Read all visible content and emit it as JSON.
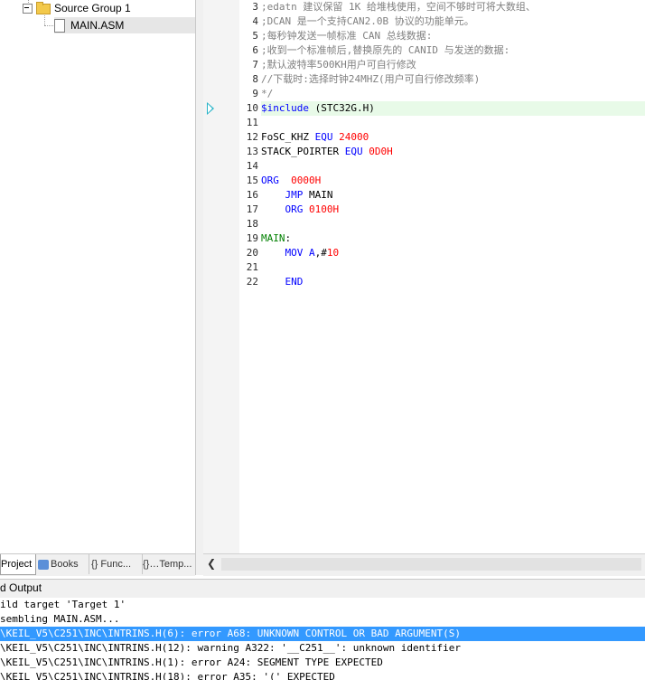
{
  "project": {
    "tree": [
      {
        "label": "Source Group 1",
        "type": "group"
      },
      {
        "label": "MAIN.ASM",
        "type": "file"
      }
    ],
    "tabs": [
      {
        "label": "Project",
        "icon": "project-icon",
        "active": true
      },
      {
        "label": "Books",
        "icon": "books-icon",
        "active": false
      },
      {
        "label": "{} Func...",
        "icon": "functions-icon",
        "active": false
      },
      {
        "label": "{}…Temp...",
        "icon": "templates-icon",
        "active": false
      }
    ]
  },
  "editor": {
    "lines": [
      {
        "n": "3",
        "text": ";edatn 建议保留 1K 给堆栈使用，空间不够时可将大数组、",
        "kind": "comment"
      },
      {
        "n": "4",
        "text": ";DCAN 是一个支持CAN2.0B 协议的功能单元。",
        "kind": "comment"
      },
      {
        "n": "5",
        "text": ";每秒钟发送一帧标准 CAN 总线数据:",
        "kind": "comment"
      },
      {
        "n": "6",
        "text": ";收到一个标准帧后,替换原先的 CANID 与发送的数据:",
        "kind": "comment"
      },
      {
        "n": "7",
        "text": ";默认波特率500KH用户可自行修改",
        "kind": "comment"
      },
      {
        "n": "8",
        "text": "//下载时:选择时钟24MHZ(用户可自行修改频率)",
        "kind": "comment"
      },
      {
        "n": "9",
        "text": "*/",
        "kind": "comment"
      },
      {
        "n": "10",
        "parts": [
          {
            "t": "$include",
            "c": "kw"
          },
          {
            "t": " (STC32G.H)",
            "c": "plain"
          }
        ],
        "highlight": true
      },
      {
        "n": "11",
        "text": "",
        "kind": "plain"
      },
      {
        "n": "12",
        "parts": [
          {
            "t": "FoSC_KHZ ",
            "c": "plain"
          },
          {
            "t": "EQU",
            "c": "kw"
          },
          {
            "t": " ",
            "c": "plain"
          },
          {
            "t": "24000",
            "c": "num"
          }
        ]
      },
      {
        "n": "13",
        "parts": [
          {
            "t": "STACK_POIRTER ",
            "c": "plain"
          },
          {
            "t": "EQU",
            "c": "kw"
          },
          {
            "t": " ",
            "c": "plain"
          },
          {
            "t": "0D0H",
            "c": "num"
          }
        ]
      },
      {
        "n": "14",
        "text": "",
        "kind": "plain"
      },
      {
        "n": "15",
        "parts": [
          {
            "t": "ORG",
            "c": "kw"
          },
          {
            "t": "  ",
            "c": "plain"
          },
          {
            "t": "0000H",
            "c": "num"
          }
        ]
      },
      {
        "n": "16",
        "parts": [
          {
            "t": "    ",
            "c": "plain"
          },
          {
            "t": "JMP",
            "c": "kw"
          },
          {
            "t": " MAIN",
            "c": "plain"
          }
        ]
      },
      {
        "n": "17",
        "parts": [
          {
            "t": "    ",
            "c": "plain"
          },
          {
            "t": "ORG",
            "c": "kw"
          },
          {
            "t": " ",
            "c": "plain"
          },
          {
            "t": "0100H",
            "c": "num"
          }
        ]
      },
      {
        "n": "18",
        "text": "",
        "kind": "plain"
      },
      {
        "n": "19",
        "parts": [
          {
            "t": "MAIN",
            "c": "lbl"
          },
          {
            "t": ":",
            "c": "plain"
          }
        ]
      },
      {
        "n": "20",
        "parts": [
          {
            "t": "    ",
            "c": "plain"
          },
          {
            "t": "MOV",
            "c": "kw"
          },
          {
            "t": " ",
            "c": "plain"
          },
          {
            "t": "A",
            "c": "kw"
          },
          {
            "t": ",#",
            "c": "plain"
          },
          {
            "t": "10",
            "c": "num"
          }
        ]
      },
      {
        "n": "21",
        "text": "",
        "kind": "plain"
      },
      {
        "n": "22",
        "parts": [
          {
            "t": "    ",
            "c": "plain"
          },
          {
            "t": "END",
            "c": "kw"
          }
        ]
      }
    ]
  },
  "output": {
    "title": "d Output",
    "lines": [
      {
        "text": "ild target 'Target 1'",
        "selected": false
      },
      {
        "text": "sembling MAIN.ASM...",
        "selected": false
      },
      {
        "text": "\\KEIL_V5\\C251\\INC\\INTRINS.H(6): error A68: UNKNOWN CONTROL OR BAD ARGUMENT(S)",
        "selected": true
      },
      {
        "text": "\\KEIL_V5\\C251\\INC\\INTRINS.H(12): warning A322: '__C251__': unknown identifier",
        "selected": false
      },
      {
        "text": "\\KEIL_V5\\C251\\INC\\INTRINS.H(1): error A24: SEGMENT TYPE EXPECTED",
        "selected": false
      },
      {
        "text": "\\KEIL_V5\\C251\\INC\\INTRINS.H(18): error A35: '(' EXPECTED",
        "selected": false
      }
    ]
  },
  "colors": {
    "comment": "#808080",
    "keyword": "#0000ff",
    "number": "#ff0000",
    "label": "#008000",
    "current_line": "#e8fae8",
    "selection": "#3399ff"
  }
}
